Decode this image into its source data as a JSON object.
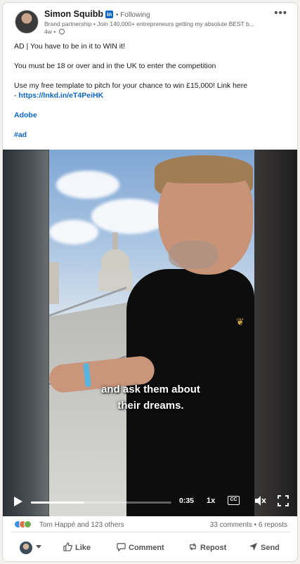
{
  "author": {
    "name": "Simon Squibb",
    "badge": "in",
    "follow_status": "• Following",
    "tagline": "Brand partnership • Join 140,000+ entrepreneurs getting my absolute BEST b...",
    "age": "4w •"
  },
  "menu": {
    "more_label": "•••"
  },
  "post": {
    "line1": "AD | You have to be in it to WIN it!",
    "line2": "You must be 18 or over and in the UK to enter the competition",
    "line3_prefix": "Use my free template to pitch for your chance to win £15,000! Link here",
    "line3_dash": "- ",
    "link": "https://lnkd.in/eT4PeiHK",
    "mention": "Adobe",
    "hashtag": "#ad"
  },
  "video": {
    "caption_line1": "and ask them about",
    "caption_line2": "their dreams.",
    "time": "0:35",
    "speed": "1x",
    "cc_label": "CC",
    "progress_fraction": 0.38
  },
  "social": {
    "reactors": "Tom Happé and 123 others",
    "comments_reposts": "33 comments • 6 reposts"
  },
  "actions": {
    "like": "Like",
    "comment": "Comment",
    "repost": "Repost",
    "send": "Send"
  },
  "colors": {
    "link": "#0a66c2",
    "like_react": "#378fe9",
    "celebrate_react": "#df704d",
    "love_react": "#6dae4f",
    "wristband": "#5ab4e0"
  }
}
